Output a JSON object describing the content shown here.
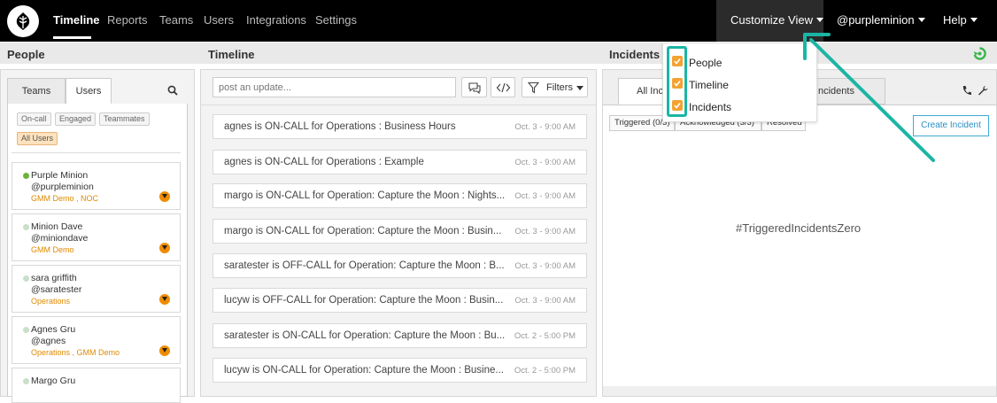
{
  "nav": {
    "items": [
      "Timeline",
      "Reports",
      "Teams",
      "Users",
      "Integrations",
      "Settings"
    ],
    "customize": "Customize View",
    "user": "@purpleminion",
    "help": "Help"
  },
  "sections": {
    "people": "People",
    "timeline": "Timeline",
    "incidents": "Incidents"
  },
  "people": {
    "tabs": [
      "Teams",
      "Users"
    ],
    "filters": [
      "On-call",
      "Engaged",
      "Teammates",
      "All Users"
    ],
    "users": [
      {
        "name": "Purple Minion",
        "handle": "@purpleminion",
        "teams": "GMM Demo , NOC",
        "oncall": true
      },
      {
        "name": "Minion Dave",
        "handle": "@miniondave",
        "teams": "GMM Demo",
        "oncall": false
      },
      {
        "name": "sara griffith",
        "handle": "@saratester",
        "teams": "Operations",
        "oncall": false
      },
      {
        "name": "Agnes Gru",
        "handle": "@agnes",
        "teams": "Operations , GMM Demo",
        "oncall": false
      },
      {
        "name": "Margo Gru",
        "handle": "",
        "teams": "",
        "oncall": false
      }
    ]
  },
  "timeline": {
    "placeholder": "post an update...",
    "filters_label": "Filters",
    "items": [
      {
        "text": "agnes is ON-CALL for Operations : Business Hours",
        "time": "Oct. 3 - 9:00 AM"
      },
      {
        "text": "agnes is ON-CALL for Operations : Example",
        "time": "Oct. 3 - 9:00 AM"
      },
      {
        "text": "margo is ON-CALL for Operation: Capture the Moon : Nights...",
        "time": "Oct. 3 - 9:00 AM"
      },
      {
        "text": "margo is ON-CALL for Operation: Capture the Moon : Busin...",
        "time": "Oct. 3 - 9:00 AM"
      },
      {
        "text": "saratester is OFF-CALL for Operation: Capture the Moon : B...",
        "time": "Oct. 3 - 9:00 AM"
      },
      {
        "text": "lucyw is OFF-CALL for Operation: Capture the Moon : Busin...",
        "time": "Oct. 3 - 9:00 AM"
      },
      {
        "text": "saratester is ON-CALL for Operation: Capture the Moon : Bu...",
        "time": "Oct. 2 - 5:00 PM"
      },
      {
        "text": "lucyw is ON-CALL for Operation: Capture the Moon : Busine...",
        "time": "Oct. 2 - 5:00 PM"
      }
    ]
  },
  "incidents": {
    "tab_all": "All Incid",
    "tab_my": "ncidents",
    "subtabs": [
      "Triggered (0/3)",
      "Acknowledged (3/3)",
      "Resolved"
    ],
    "create": "Create Incident",
    "zero": "#TriggeredIncidentsZero"
  },
  "customize_menu": {
    "options": [
      {
        "label": "People",
        "checked": true
      },
      {
        "label": "Timeline",
        "checked": true
      },
      {
        "label": "Incidents",
        "checked": true
      }
    ]
  },
  "colors": {
    "accent_teal": "#1bb5a5",
    "checkbox_orange": "#f3a233",
    "team_orange": "#e08a00"
  }
}
